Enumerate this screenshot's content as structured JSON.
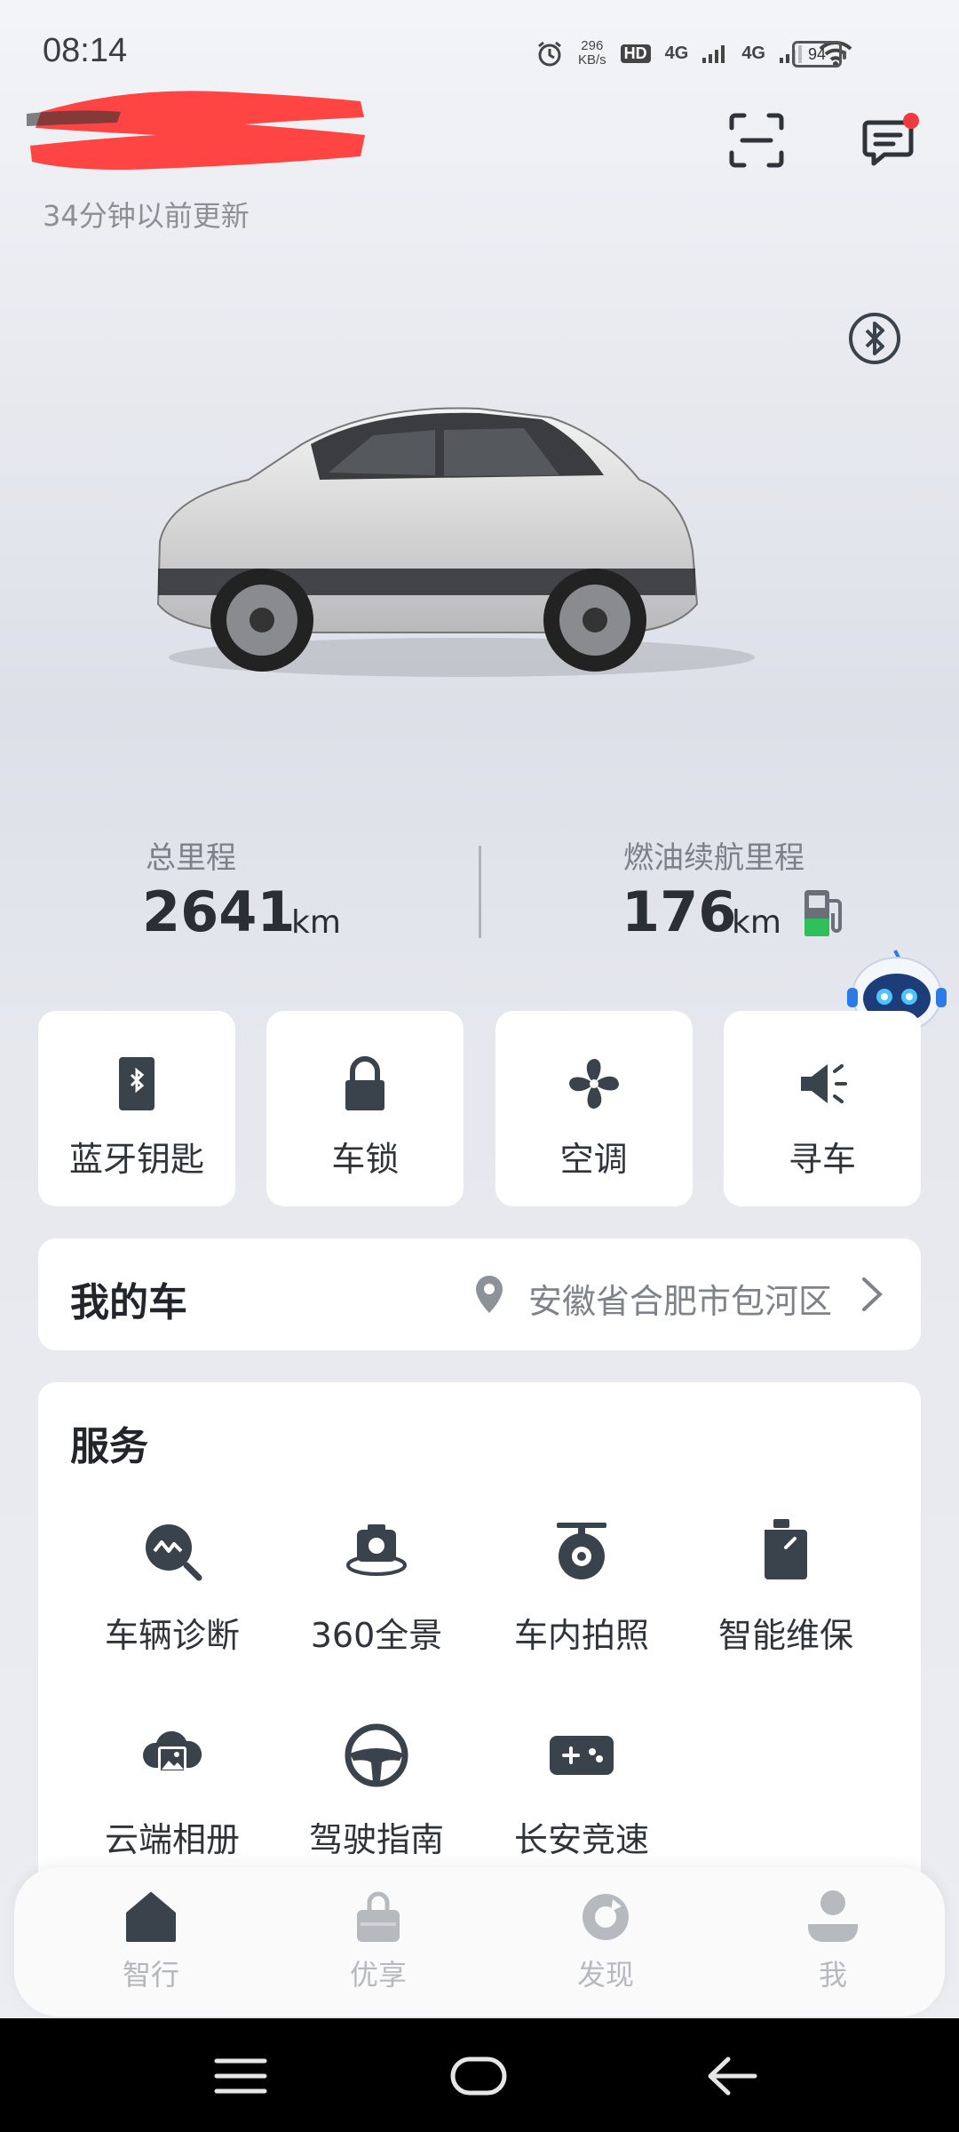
{
  "status_bar": {
    "time": "08:14",
    "net_speed_value": "296",
    "net_speed_unit": "KB/s",
    "hd_label": "HD",
    "signal1": "4G",
    "signal2": "4G",
    "battery": "94"
  },
  "header": {
    "updated_text": "34分钟以前更新",
    "unread_dot_color": "#ef3b3b"
  },
  "stats": {
    "total_label": "总里程",
    "total_value": "2641",
    "total_unit": "km",
    "range_label": "燃油续航里程",
    "range_value": "176",
    "range_unit": "km"
  },
  "quick_actions": [
    {
      "label": "蓝牙钥匙",
      "icon": "bluetooth-key-icon"
    },
    {
      "label": "车锁",
      "icon": "lock-icon"
    },
    {
      "label": "空调",
      "icon": "fan-icon"
    },
    {
      "label": "寻车",
      "icon": "speaker-icon"
    }
  ],
  "my_car": {
    "title": "我的车",
    "location": "安徽省合肥市包河区"
  },
  "services": {
    "title": "服务",
    "items": [
      {
        "label": "车辆诊断",
        "icon": "diagnosis-icon"
      },
      {
        "label": "360全景",
        "icon": "panorama-camera-icon"
      },
      {
        "label": "车内拍照",
        "icon": "interior-camera-icon"
      },
      {
        "label": "智能维保",
        "icon": "maintenance-icon"
      },
      {
        "label": "云端相册",
        "icon": "cloud-album-icon"
      },
      {
        "label": "驾驶指南",
        "icon": "steering-wheel-icon"
      },
      {
        "label": "长安竞速",
        "icon": "gamepad-icon"
      }
    ]
  },
  "tabs": [
    {
      "label": "智行",
      "icon": "home-icon",
      "active": true
    },
    {
      "label": "优享",
      "icon": "shopping-bag-icon",
      "active": false
    },
    {
      "label": "发现",
      "icon": "discover-icon",
      "active": false
    },
    {
      "label": "我",
      "icon": "profile-icon",
      "active": false
    }
  ],
  "colors": {
    "icon_dark": "#3a424c",
    "fuel_green": "#2fbf5b",
    "redaction_red": "#ff4444"
  }
}
